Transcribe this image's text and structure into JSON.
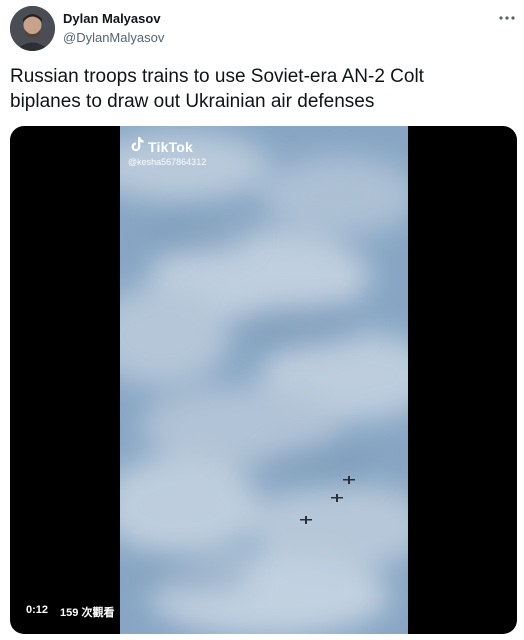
{
  "author": {
    "display_name": "Dylan Malyasov",
    "handle": "@DylanMalyasov"
  },
  "tweet": {
    "text": "Russian troops trains to use Soviet-era AN-2 Colt\nbiplanes to draw out  Ukrainian air defenses"
  },
  "media": {
    "watermark_brand": "TikTok",
    "watermark_user": "@kesha567864312",
    "time": "0:12",
    "views": "159 次觀看",
    "icons": [
      "more-icon",
      "tiktok-note-icon"
    ]
  }
}
